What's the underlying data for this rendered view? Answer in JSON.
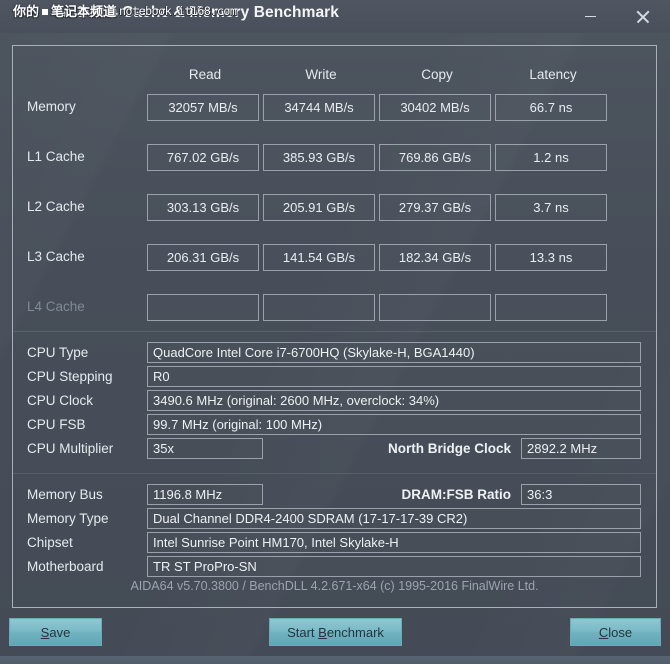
{
  "window": {
    "title": "AIDA64 Cache & Memory Benchmark",
    "minimize_label": "minimize",
    "close_label": "close"
  },
  "watermark": {
    "cn_text": "你的",
    "cn_text2": "笔记本频道",
    "url": "notebook.it168.com"
  },
  "benchmark": {
    "columns": [
      "Read",
      "Write",
      "Copy",
      "Latency"
    ],
    "rows": [
      {
        "label": "Memory",
        "dim": false,
        "values": [
          "32057 MB/s",
          "34744 MB/s",
          "30402 MB/s",
          "66.7 ns"
        ]
      },
      {
        "label": "L1 Cache",
        "dim": false,
        "values": [
          "767.02 GB/s",
          "385.93 GB/s",
          "769.86 GB/s",
          "1.2 ns"
        ]
      },
      {
        "label": "L2 Cache",
        "dim": false,
        "values": [
          "303.13 GB/s",
          "205.91 GB/s",
          "279.37 GB/s",
          "3.7 ns"
        ]
      },
      {
        "label": "L3 Cache",
        "dim": false,
        "values": [
          "206.31 GB/s",
          "141.54 GB/s",
          "182.34 GB/s",
          "13.3 ns"
        ]
      },
      {
        "label": "L4 Cache",
        "dim": true,
        "values": [
          "",
          "",
          "",
          ""
        ]
      }
    ]
  },
  "cpu_info": {
    "type_label": "CPU Type",
    "type_value": "QuadCore Intel Core i7-6700HQ  (Skylake-H, BGA1440)",
    "stepping_label": "CPU Stepping",
    "stepping_value": "R0",
    "clock_label": "CPU Clock",
    "clock_value": "3490.6 MHz  (original: 2600 MHz, overclock: 34%)",
    "fsb_label": "CPU FSB",
    "fsb_value": "99.7 MHz  (original: 100 MHz)",
    "multiplier_label": "CPU Multiplier",
    "multiplier_value": "35x",
    "north_bridge_label": "North Bridge Clock",
    "north_bridge_value": "2892.2 MHz"
  },
  "memory_info": {
    "bus_label": "Memory Bus",
    "bus_value": "1196.8 MHz",
    "ratio_label": "DRAM:FSB Ratio",
    "ratio_value": "36:3",
    "type_label": "Memory Type",
    "type_value": "Dual Channel DDR4-2400 SDRAM  (17-17-17-39 CR2)",
    "chipset_label": "Chipset",
    "chipset_value": "Intel Sunrise Point HM170, Intel Skylake-H",
    "motherboard_label": "Motherboard",
    "motherboard_value": "TR ST ProPro-SN"
  },
  "version_line": "AIDA64 v5.70.3800 / BenchDLL 4.2.671-x64  (c) 1995-2016 FinalWire Ltd.",
  "footer": {
    "save": {
      "pre": "",
      "accel": "S",
      "post": "ave"
    },
    "start": {
      "pre": "Start ",
      "accel": "B",
      "post": "enchmark"
    },
    "close": {
      "pre": "",
      "accel": "C",
      "post": "lose"
    }
  },
  "colors": {
    "window_bg": "#474e5a",
    "panel_border": "#a9b0b8",
    "text": "#e6eaee",
    "dim_text": "#7f8a96",
    "button_accent": "#79b9c6"
  }
}
